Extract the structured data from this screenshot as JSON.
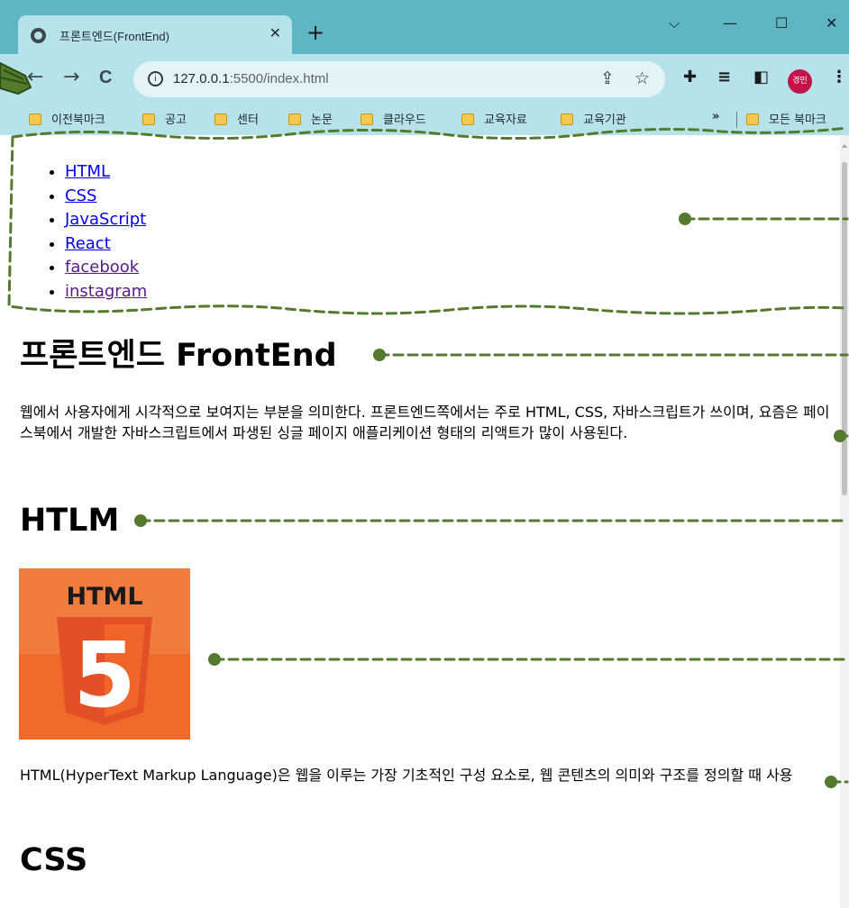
{
  "browser": {
    "tab_title": "프론트엔드(FrontEnd)",
    "tab_close": "✕",
    "new_tab": "+",
    "window_controls": {
      "collapse": "⌵",
      "minimize": "—",
      "maximize": "☐",
      "close": "✕"
    },
    "nav": {
      "back": "←",
      "forward": "→",
      "reload": "C"
    },
    "url_host": "127.0.0.1",
    "url_rest": ":5500/index.html",
    "info_glyph": "i",
    "share_glyph": "⇪",
    "star_glyph": "☆",
    "extensions_glyph": "✚",
    "reading_list_glyph": "≡",
    "side_panel_glyph": "◧",
    "profile_label": "경민",
    "menu_glyph": "⋮",
    "bookmarks": [
      "이전북마크",
      "공고",
      "센터",
      "논문",
      "클라우드",
      "교육자료",
      "교육기관"
    ],
    "bookmarks_overflow": "»",
    "all_bookmarks": "모든 북마크"
  },
  "page": {
    "nav_links": [
      "HTML",
      "CSS",
      "JavaScript",
      "React",
      "facebook",
      "instagram"
    ],
    "heading": "프론트엔드 FrontEnd",
    "intro": "웹에서 사용자에게 시각적으로 보여지는 부분을 의미한다. 프론트엔드쪽에서는 주로 HTML, CSS, 자바스크립트가 쓰이며, 요즘은 페이스북에서 개발한 자바스크립트에서 파생된 싱글 페이지 애플리케이션 형태의 리액트가 많이 사용된다.",
    "section_html_title": "HTLM",
    "html_logo_text": "HTML",
    "html_logo_digit": "5",
    "html_desc": "HTML(HyperText Markup Language)은 웹을 이루는 가장 기초적인 구성 요소로, 웹 콘텐츠의 의미와 구조를 정의할 때 사용",
    "section_css_title": "CSS"
  },
  "colors": {
    "chrome_frame": "#5eb6c4",
    "chrome_toolbar": "#b6e2e9",
    "annotation": "#547a2e",
    "html5_orange": "#f15a24",
    "html5_bg": "#f07b3f"
  },
  "icons": [
    "globe-icon",
    "close-icon",
    "plus-icon",
    "back-arrow-icon",
    "forward-arrow-icon",
    "reload-icon",
    "info-icon",
    "share-icon",
    "star-icon",
    "puzzle-icon",
    "reading-list-icon",
    "side-panel-icon",
    "kebab-menu-icon",
    "folder-icon",
    "html5-logo",
    "hand-arrow-icon"
  ]
}
